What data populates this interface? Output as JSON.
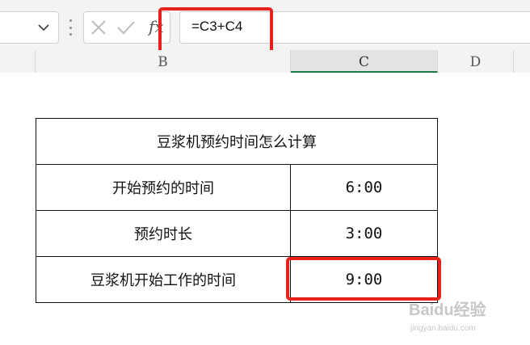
{
  "formula_bar": {
    "cancel_icon": "close-icon",
    "confirm_icon": "check-icon",
    "fx_label": "fx",
    "formula": "=C3+C4"
  },
  "columns": [
    {
      "label": "B"
    },
    {
      "label": "C"
    },
    {
      "label": "D"
    }
  ],
  "table": {
    "title": "豆浆机预约时间怎么计算",
    "rows": [
      {
        "label": "开始预约的时间",
        "value": "6:00"
      },
      {
        "label": "预约时长",
        "value": "3:00"
      },
      {
        "label": "豆浆机开始工作的时间",
        "value": "9:00"
      }
    ]
  },
  "watermark": {
    "brand": "Baidu经验",
    "url": "jingyan.baidu.com"
  },
  "colors": {
    "highlight": "#e8211d",
    "active_column": "#1e7a45"
  }
}
